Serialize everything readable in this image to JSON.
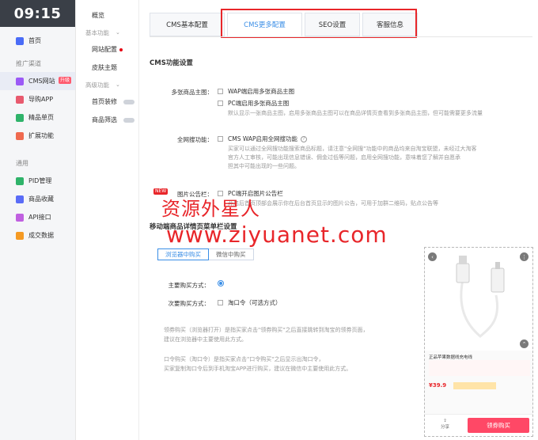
{
  "brand": {
    "time": "09:15"
  },
  "sidebar": {
    "items_top": [
      {
        "label": "首页",
        "color": "#4a6cf7"
      }
    ],
    "section1": "推广渠道",
    "items_mid": [
      {
        "label": "CMS网站",
        "color": "#9b59f6",
        "badge": "升级"
      },
      {
        "label": "导购APP",
        "color": "#e85a6e"
      },
      {
        "label": "精品单页",
        "color": "#2fb36a"
      },
      {
        "label": "扩展功能",
        "color": "#ef6a4f"
      }
    ],
    "section2": "通用",
    "items_bottom": [
      {
        "label": "PID管理",
        "color": "#2fb36a"
      },
      {
        "label": "商品收藏",
        "color": "#5a6cf7"
      },
      {
        "label": "API接口",
        "color": "#c060e0"
      },
      {
        "label": "成交数据",
        "color": "#f59a23"
      }
    ]
  },
  "subnav": {
    "overview": "概览",
    "basic_group": "基本功能",
    "site_config": "网站配置",
    "skin": "皮肤主题",
    "advanced_group": "高级功能",
    "homepage_category": "首页装修",
    "product_filter": "商品筛选"
  },
  "tabs": [
    {
      "label": "CMS基本配置"
    },
    {
      "label": "CMS更多配置"
    },
    {
      "label": "SEO设置"
    },
    {
      "label": "客服信息"
    }
  ],
  "section_cms": {
    "title": "CMS功能设置",
    "multi_image_label": "多张商品主图：",
    "multi_image_opt1": "WAP端启用多张商品主图",
    "multi_image_opt2": "PC端启用多张商品主图",
    "multi_image_desc": "默认显示一张商品主图，启用多张商品主图可以在商品详情页查看到多张商品主图，但可能需要更多流量",
    "search_label": "全网搜功能：",
    "search_opt": "CMS WAP启用全网搜功能",
    "search_desc1": "买家可以通过全网搜功能搜索商品标题，请注意\"全网搜\"功能中的商品均来自淘宝联盟，未经过大淘客",
    "search_desc2": "官方人工审核，可能出现信息错误、佣金过低等问题，启用全网搜功能，意味着您了解并自愿承",
    "search_desc3": "担其中可能出现的一些问题。",
    "new_tag": "NEW",
    "ad_label": "图片公告栏：",
    "ad_opt": "PC端开启图片公告栏",
    "ad_desc": "开启后首页顶部会展示你在后台首页显示的图片公告，可用于加群二维码，贴点公告等"
  },
  "section_mobile": {
    "title": "移动端商品详情页菜单栏设置",
    "btn_browser": "浏览器中购买",
    "btn_wechat": "微信中购买",
    "main_buy_label": "主要购买方式：",
    "secondary_buy_label": "次要购买方式：",
    "secondary_opt": "淘口令（可选方式）",
    "note1_a": "领券购买（浏览器打开）是指买家点击\"领券购买\"之后直接跳转到淘宝的领券页面，",
    "note1_b": "建议在浏览器中主要使用此方式。",
    "note2_a": "口令购买（淘口令）是指买家点击\"口令购买\"之后显示出淘口令，",
    "note2_b": "买家复制淘口令后到手机淘宝APP进行购买，建议在微信中主要使用此方式。"
  },
  "phone_preview": {
    "product_title": "正品苹果数据线充电线",
    "price": "¥39.9",
    "share_label": "分享",
    "buy_label": "领券购买"
  },
  "watermark": {
    "line1": "资源外星人",
    "line2": "www.ziyuanet.com"
  }
}
